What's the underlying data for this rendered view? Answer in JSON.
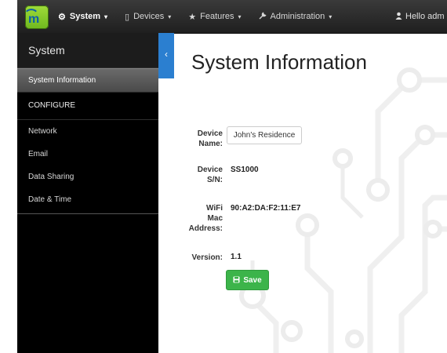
{
  "navbar": {
    "menu": [
      {
        "icon": "gear-icon",
        "glyph": "⚙",
        "label": "System",
        "active": true
      },
      {
        "icon": "tablet-icon",
        "glyph": "▯",
        "label": "Devices",
        "active": false
      },
      {
        "icon": "star-icon",
        "glyph": "★",
        "label": "Features",
        "active": false
      },
      {
        "icon": "wrench-icon",
        "glyph": "🔧",
        "label": "Administration",
        "active": false
      }
    ],
    "user_greeting": "Hello adm",
    "caret": "▾"
  },
  "sidebar": {
    "title": "System",
    "active_item": "System Information",
    "section_heading": "CONFIGURE",
    "items": [
      "Network",
      "Email",
      "Data Sharing",
      "Date & Time"
    ],
    "collapse_glyph": "‹"
  },
  "main": {
    "title": "System Information",
    "fields": {
      "device_name": {
        "label_line1": "Device",
        "label_line2": "Name:",
        "value": "John's Residence"
      },
      "device_sn": {
        "label_line1": "Device",
        "label_line2": "S/N:",
        "value": "SS1000"
      },
      "wifi_mac": {
        "label_line1": "WiFi",
        "label_line2": "Mac",
        "label_line3": "Address:",
        "value": "90:A2:DA:F2:11:E7"
      },
      "version": {
        "label": "Version:",
        "value": "1.1"
      }
    },
    "save_label": "Save",
    "save_icon": "floppy-disk-icon"
  },
  "colors": {
    "navbar": "#2a2a2a",
    "sidebar": "#000000",
    "accent_blue": "#2b7fd0",
    "save_green": "#3cb44a",
    "logo_green": "#8cc63f"
  }
}
